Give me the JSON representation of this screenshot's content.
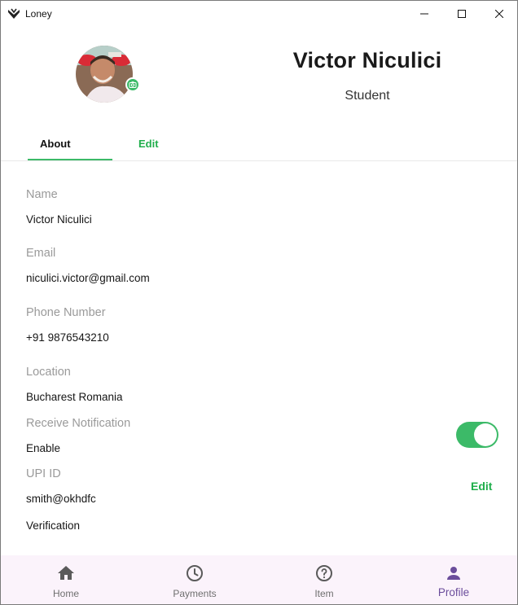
{
  "window": {
    "title": "Loney"
  },
  "profile": {
    "name": "Victor Niculici",
    "role": "Student"
  },
  "tabs": [
    {
      "label": "About",
      "active": true
    },
    {
      "label": "Edit",
      "active": false
    }
  ],
  "fields": {
    "name": {
      "label": "Name",
      "value": "Victor Niculici"
    },
    "email": {
      "label": "Email",
      "value": "niculici.victor@gmail.com"
    },
    "phone": {
      "label": "Phone Number",
      "value": "+91 9876543210"
    },
    "location": {
      "label": "Location",
      "value": "Bucharest Romania"
    },
    "notification": {
      "label": "Receive Notification",
      "value": "Enable",
      "enabled": true
    },
    "upi": {
      "label": "UPI ID",
      "value": "smith@okhdfc",
      "edit_label": "Edit"
    },
    "verification": {
      "value": "Verification"
    }
  },
  "bottom_nav": [
    {
      "label": "Home",
      "icon": "home-icon"
    },
    {
      "label": "Payments",
      "icon": "clock-icon"
    },
    {
      "label": "Item",
      "icon": "help-icon"
    },
    {
      "label": "Profile",
      "icon": "person-icon",
      "active": true
    }
  ],
  "colors": {
    "accent_green": "#3cba68",
    "nav_active": "#6b4d9b",
    "nav_bg": "#fbf3fb"
  }
}
